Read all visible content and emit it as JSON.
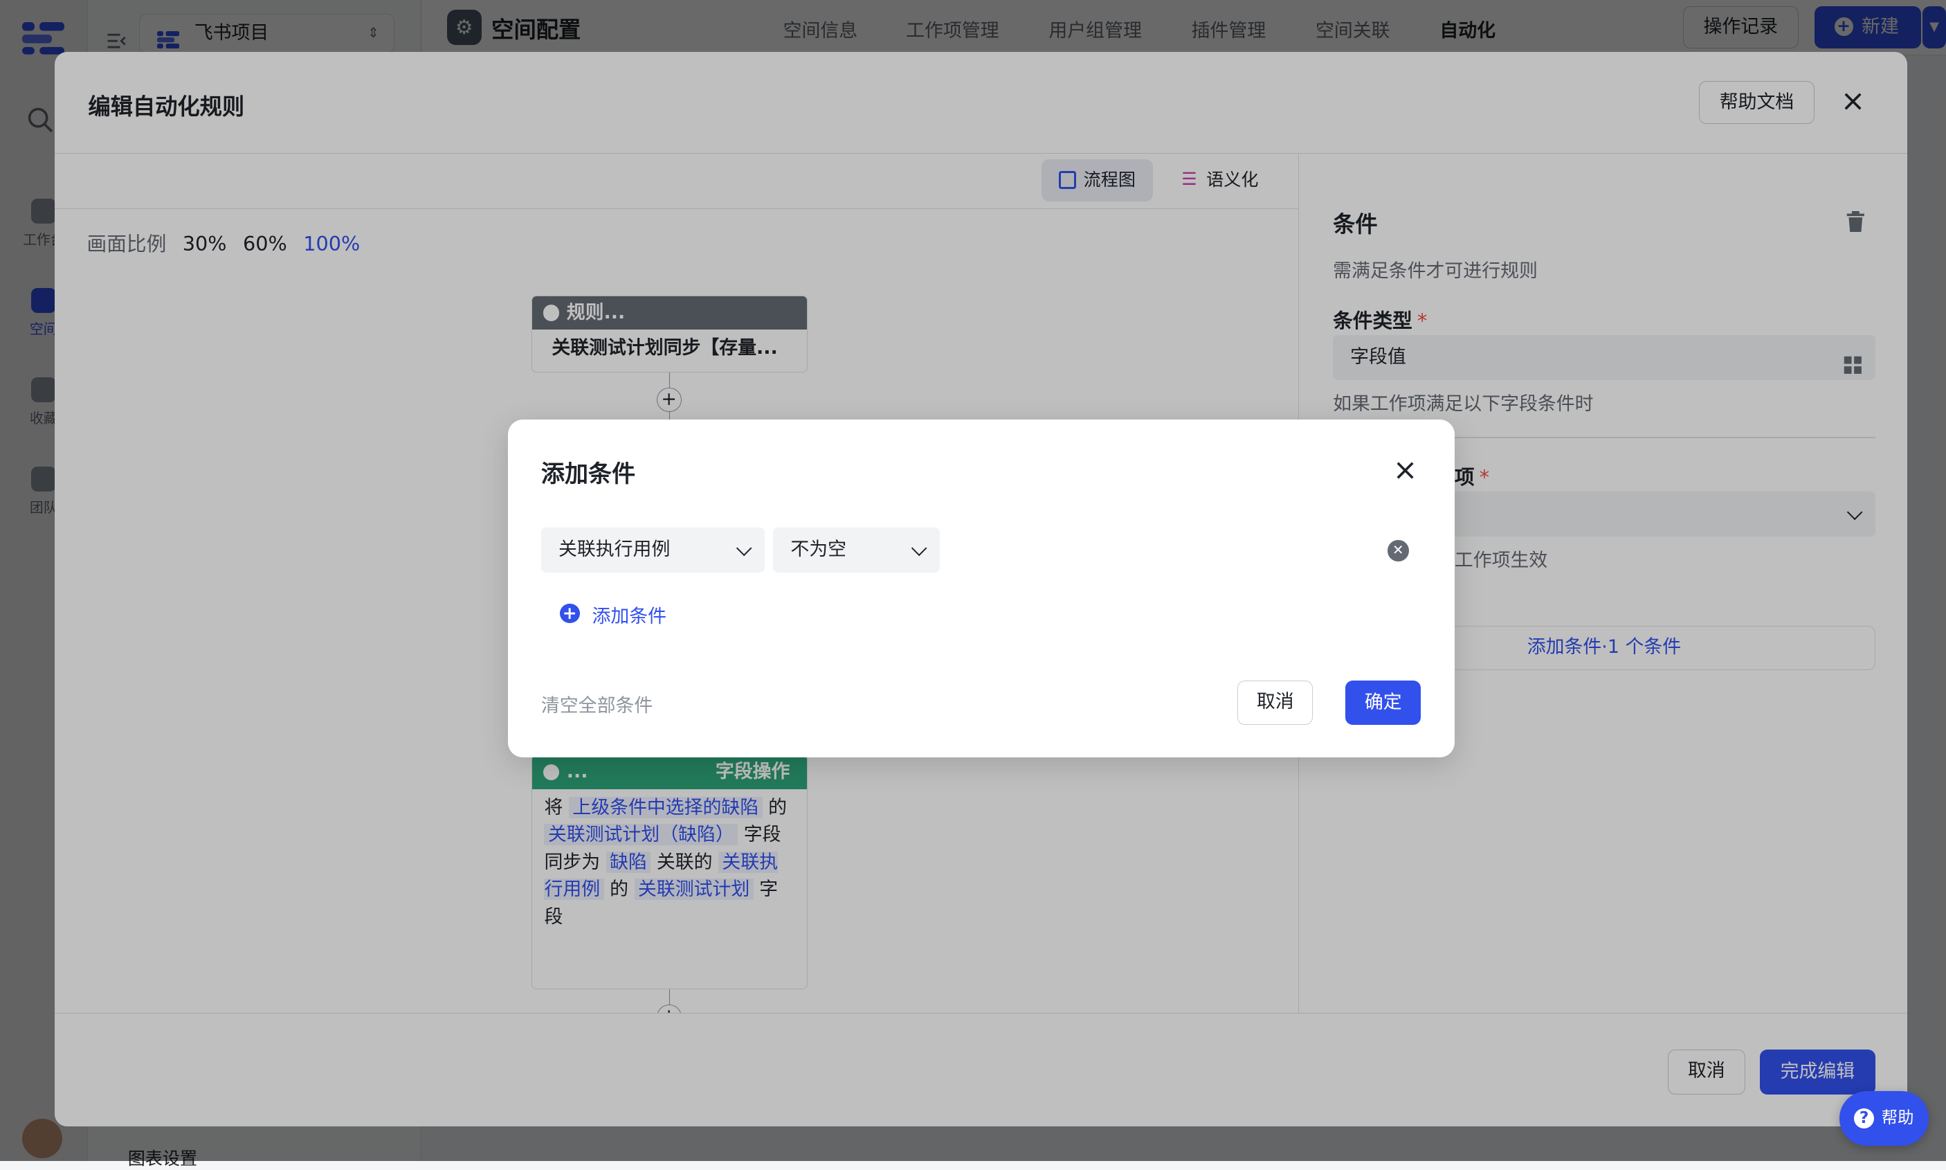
{
  "app": {
    "project_name": "飞书项目",
    "page_title": "空间配置",
    "nav_items": [
      {
        "label": "工作台",
        "icon": "home-icon"
      },
      {
        "label": "空间",
        "icon": "space-icon"
      },
      {
        "label": "收藏",
        "icon": "star-icon"
      },
      {
        "label": "团队",
        "icon": "team-icon"
      }
    ],
    "tabs": [
      "空间信息",
      "工作项管理",
      "用户组管理",
      "插件管理",
      "空间关联",
      "自动化"
    ],
    "active_tab": "自动化",
    "operation_log": "操作记录",
    "new_button": "新建",
    "sidebar_bottom_item": "图表设置"
  },
  "drawer": {
    "title": "编辑自动化规则",
    "help_doc": "帮助文档",
    "view_flow": "流程图",
    "view_semantic": "语义化",
    "scale_label": "画面比例",
    "scales": [
      "30%",
      "60%",
      "100%"
    ],
    "active_scale": "100%",
    "rule_node": {
      "header": "规则...",
      "body": "关联测试计划同步【存量..."
    },
    "action_node": {
      "header_left": "...",
      "header_right": "字段操作",
      "t1": "将",
      "h1": "上级条件中选择的缺陷",
      "t2": "的",
      "h2": "关联测试计划（缺陷）",
      "t3": "字段同步为",
      "h3": "缺陷",
      "t4": "关联的",
      "h4": "关联执行用例",
      "t5": "的",
      "h5": "关联测试计划",
      "t6": "字段"
    },
    "bottom_node_header": "...",
    "panel": {
      "title": "条件",
      "subtitle": "需满足条件才可进行规则",
      "cond_type_label": "条件类型",
      "cond_type_value": "字段值",
      "cond_type_hint": "如果工作项满足以下字段条件时",
      "item_label_partial": "项",
      "item_hint_partial": "工作项生效",
      "add_cond_btn": "添加条件·1 个条件"
    },
    "cancel": "取消",
    "finish": "完成编辑"
  },
  "modal": {
    "title": "添加条件",
    "field_select": "关联执行用例",
    "operator_select": "不为空",
    "add_condition": "添加条件",
    "clear_all": "清空全部条件",
    "cancel": "取消",
    "confirm": "确定"
  },
  "help_fab": "帮助",
  "colors": {
    "primary": "#3250eb",
    "rule_header": "#646a73",
    "action_header": "#2ea57a",
    "danger": "#f54a45"
  }
}
